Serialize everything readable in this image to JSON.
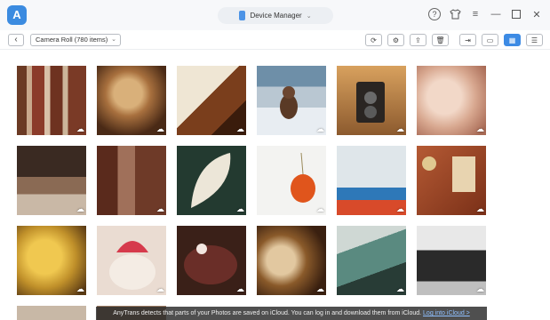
{
  "titlebar": {
    "app_logo": "A",
    "device_name": "Device Manager",
    "icons": [
      "help-icon",
      "shirt-icon",
      "menu-icon",
      "minimize-icon",
      "maximize-icon",
      "close-icon"
    ]
  },
  "toolbar": {
    "album": "Camera Roll (780 items)",
    "tools": [
      "refresh-icon",
      "settings-icon",
      "upload-icon",
      "delete-icon",
      "export-icon",
      "to-computer-icon",
      "grid-view-icon",
      "list-view-icon"
    ]
  },
  "notice": {
    "text": "AnyTrans detects that parts of your Photos are saved on iCloud. You can log in and download them from iCloud.",
    "link": "Log into iCloud >"
  }
}
